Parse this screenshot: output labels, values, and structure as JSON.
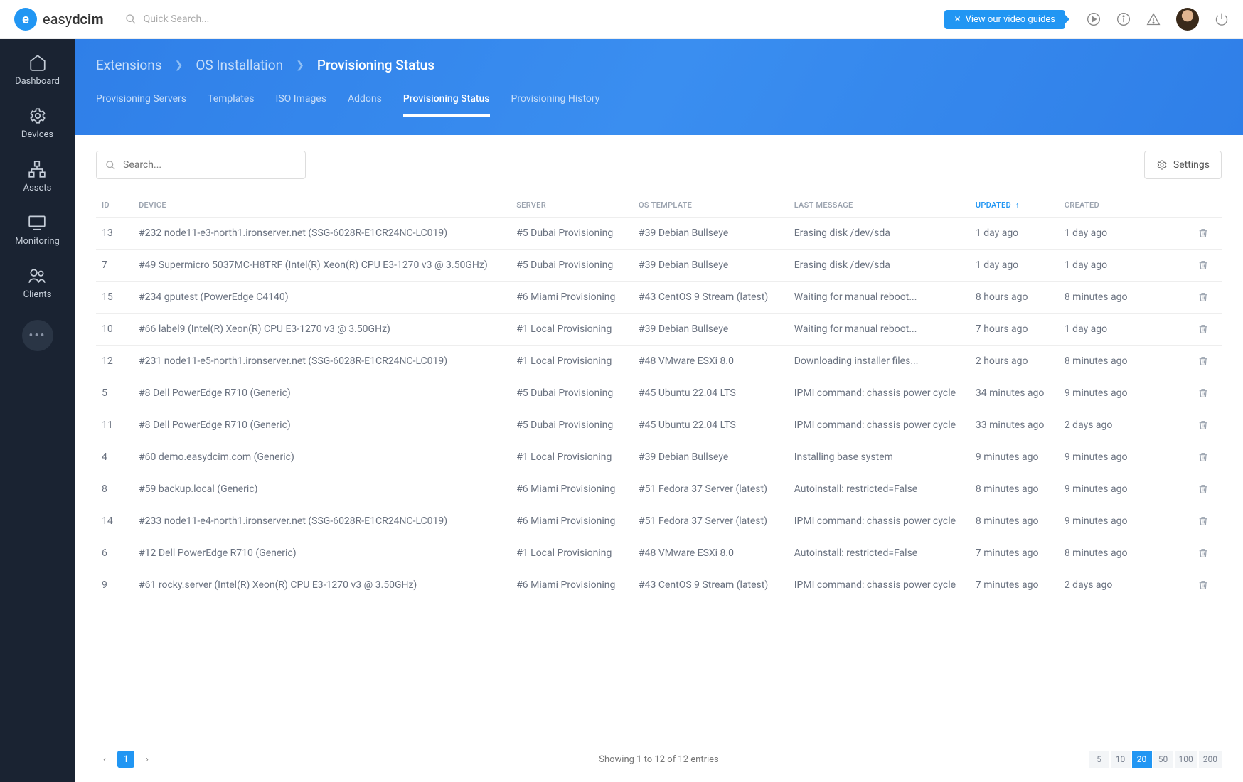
{
  "topbar": {
    "logo_prefix": "easy",
    "logo_bold": "dcim",
    "quick_search_placeholder": "Quick Search...",
    "video_guide_label": "View our video guides"
  },
  "sidebar": {
    "items": [
      {
        "label": "Dashboard"
      },
      {
        "label": "Devices"
      },
      {
        "label": "Assets"
      },
      {
        "label": "Monitoring"
      },
      {
        "label": "Clients"
      }
    ]
  },
  "breadcrumb": {
    "a": "Extensions",
    "b": "OS Installation",
    "c": "Provisioning Status"
  },
  "subtabs": [
    {
      "label": "Provisioning Servers"
    },
    {
      "label": "Templates"
    },
    {
      "label": "ISO Images"
    },
    {
      "label": "Addons"
    },
    {
      "label": "Provisioning Status",
      "active": true
    },
    {
      "label": "Provisioning History"
    }
  ],
  "search_placeholder": "Search...",
  "settings_label": "Settings",
  "columns": {
    "id": "ID",
    "device": "Device",
    "server": "Server",
    "template": "OS Template",
    "message": "Last Message",
    "updated": "Updated",
    "created": "Created"
  },
  "rows": [
    {
      "id": "13",
      "device": "#232 node11-e3-north1.ironserver.net (SSG-6028R-E1CR24NC-LC019)",
      "server": "#5 Dubai Provisioning",
      "template": "#39 Debian Bullseye",
      "message": "Erasing disk /dev/sda",
      "updated": "1 day ago",
      "created": "1 day ago"
    },
    {
      "id": "7",
      "device": "#49 Supermicro 5037MC-H8TRF (Intel(R) Xeon(R) CPU E3-1270 v3 @ 3.50GHz)",
      "server": "#5 Dubai Provisioning",
      "template": "#39 Debian Bullseye",
      "message": "Erasing disk /dev/sda",
      "updated": "1 day ago",
      "created": "1 day ago"
    },
    {
      "id": "15",
      "device": "#234 gputest (PowerEdge C4140)",
      "server": "#6 Miami Provisioning",
      "template": "#43 CentOS 9 Stream (latest)",
      "message": "Waiting for manual reboot...",
      "updated": "8 hours ago",
      "created": "8 minutes ago"
    },
    {
      "id": "10",
      "device": "#66 label9 (Intel(R) Xeon(R) CPU E3-1270 v3 @ 3.50GHz)",
      "server": "#1 Local Provisioning",
      "template": "#39 Debian Bullseye",
      "message": "Waiting for manual reboot...",
      "updated": "7 hours ago",
      "created": "1 day ago"
    },
    {
      "id": "12",
      "device": "#231 node11-e5-north1.ironserver.net (SSG-6028R-E1CR24NC-LC019)",
      "server": "#1 Local Provisioning",
      "template": "#48 VMware ESXi 8.0",
      "message": "Downloading installer files...",
      "updated": "2 hours ago",
      "created": "8 minutes ago"
    },
    {
      "id": "5",
      "device": "#8 Dell PowerEdge R710 (Generic)",
      "server": "#5 Dubai Provisioning",
      "template": "#45 Ubuntu 22.04 LTS",
      "message": "IPMI command: chassis power cycle",
      "updated": "34 minutes ago",
      "created": "9 minutes ago"
    },
    {
      "id": "11",
      "device": "#8 Dell PowerEdge R710 (Generic)",
      "server": "#5 Dubai Provisioning",
      "template": "#45 Ubuntu 22.04 LTS",
      "message": "IPMI command: chassis power cycle",
      "updated": "33 minutes ago",
      "created": "2 days ago"
    },
    {
      "id": "4",
      "device": "#60 demo.easydcim.com (Generic)",
      "server": "#1 Local Provisioning",
      "template": "#39 Debian Bullseye",
      "message": "Installing base system",
      "updated": "9 minutes ago",
      "created": "9 minutes ago"
    },
    {
      "id": "8",
      "device": "#59 backup.local (Generic)",
      "server": "#6 Miami Provisioning",
      "template": "#51 Fedora 37 Server (latest)",
      "message": "Autoinstall: restricted=False",
      "updated": "8 minutes ago",
      "created": "9 minutes ago"
    },
    {
      "id": "14",
      "device": "#233 node11-e4-north1.ironserver.net (SSG-6028R-E1CR24NC-LC019)",
      "server": "#6 Miami Provisioning",
      "template": "#51 Fedora 37 Server (latest)",
      "message": "IPMI command: chassis power cycle",
      "updated": "8 minutes ago",
      "created": "9 minutes ago"
    },
    {
      "id": "6",
      "device": "#12 Dell PowerEdge R710 (Generic)",
      "server": "#1 Local Provisioning",
      "template": "#48 VMware ESXi 8.0",
      "message": "Autoinstall: restricted=False",
      "updated": "7 minutes ago",
      "created": "8 minutes ago"
    },
    {
      "id": "9",
      "device": "#61 rocky.server (Intel(R) Xeon(R) CPU E3-1270 v3 @ 3.50GHz)",
      "server": "#6 Miami Provisioning",
      "template": "#43 CentOS 9 Stream (latest)",
      "message": "IPMI command: chassis power cycle",
      "updated": "7 minutes ago",
      "created": "2 days ago"
    }
  ],
  "pager": {
    "current": "1",
    "showing": "Showing 1 to 12 of 12 entries"
  },
  "page_sizes": [
    "5",
    "10",
    "20",
    "50",
    "100",
    "200"
  ],
  "page_size_active": "20"
}
